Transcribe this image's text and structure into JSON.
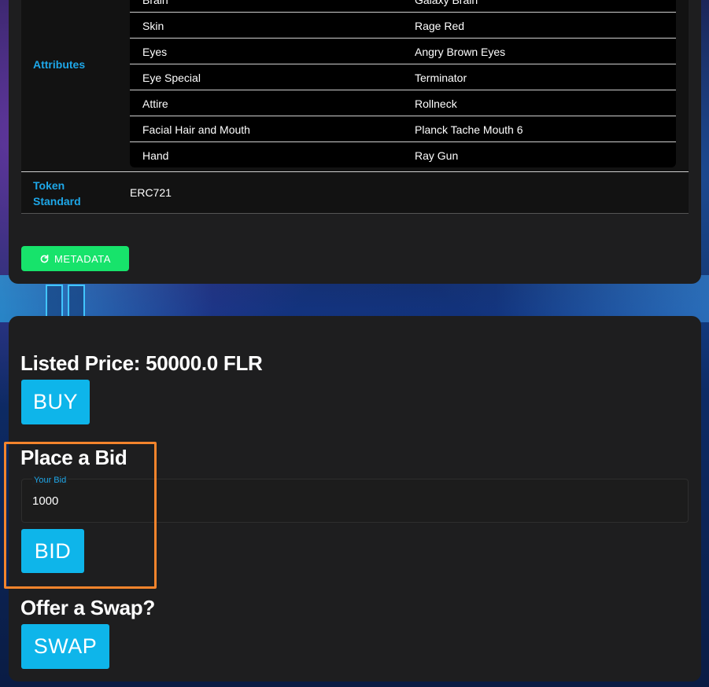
{
  "properties": {
    "attributes_label": "Attributes",
    "attributes": [
      {
        "key": "Brain",
        "value": "Galaxy Brain"
      },
      {
        "key": "Skin",
        "value": "Rage Red"
      },
      {
        "key": "Eyes",
        "value": "Angry Brown Eyes"
      },
      {
        "key": "Eye Special",
        "value": "Terminator"
      },
      {
        "key": "Attire",
        "value": "Rollneck"
      },
      {
        "key": "Facial Hair and Mouth",
        "value": "Planck Tache Mouth 6"
      },
      {
        "key": "Hand",
        "value": "Ray Gun"
      }
    ],
    "token_standard_label_line1": "Token",
    "token_standard_label_line2": "Standard",
    "token_standard_value": "ERC721"
  },
  "metadata_button": {
    "label": "METADATA",
    "icon": "refresh-icon"
  },
  "listing": {
    "price_heading": "Listed Price: 50000.0 FLR",
    "buy_label": "BUY"
  },
  "bid": {
    "heading": "Place a Bid",
    "field_label": "Your Bid",
    "field_value": "1000",
    "bid_label": "BID"
  },
  "swap": {
    "heading": "Offer a Swap?",
    "swap_label": "SWAP"
  },
  "colors": {
    "accent": "#0eb5ea",
    "label_blue": "#1ea7e8",
    "metadata_green": "#17e36b",
    "highlight": "#f4842c",
    "card_bg": "#1e1e1f"
  }
}
